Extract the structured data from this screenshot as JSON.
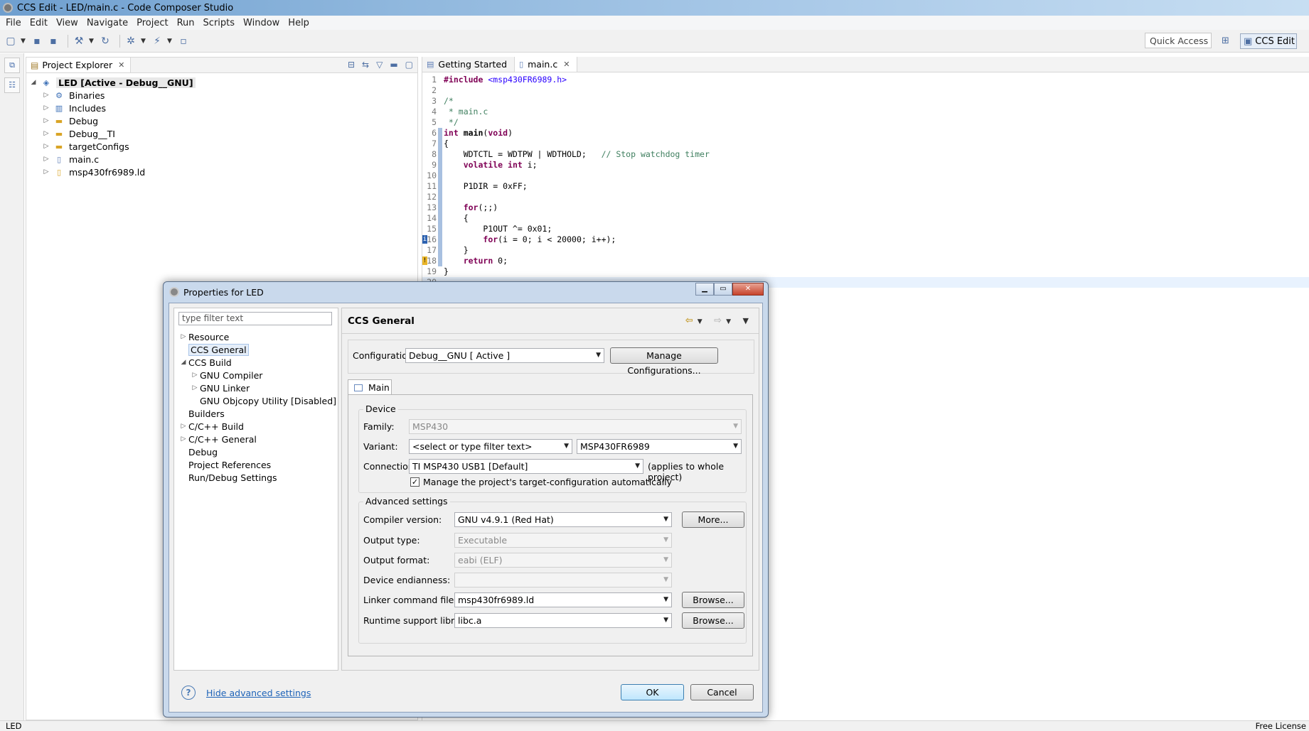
{
  "window": {
    "title": "CCS Edit - LED/main.c - Code Composer Studio"
  },
  "menu": [
    "File",
    "Edit",
    "View",
    "Navigate",
    "Project",
    "Run",
    "Scripts",
    "Window",
    "Help"
  ],
  "toolbar": {
    "quick_access": "Quick Access",
    "perspective": "CCS Edit"
  },
  "explorer": {
    "tab_label": "Project Explorer",
    "root": "LED  [Active - Debug__GNU]",
    "items": [
      "Binaries",
      "Includes",
      "Debug",
      "Debug__TI",
      "targetConfigs",
      "main.c",
      "msp430fr6989.ld"
    ],
    "icons": [
      "binaries-icon",
      "includes-icon",
      "folder-icon",
      "folder-icon",
      "folder-icon",
      "c-file-icon",
      "linker-file-icon"
    ]
  },
  "editor": {
    "tabs": [
      "Getting Started",
      "main.c"
    ],
    "lines": [
      {
        "n": "1",
        "html": "<span class=\"kw\">#include</span> <span class=\"inc\">&lt;msp430FR6989.h&gt;</span>"
      },
      {
        "n": "2",
        "html": ""
      },
      {
        "n": "3",
        "html": "<span class=\"cmt\">/*</span>"
      },
      {
        "n": "4",
        "html": "<span class=\"cmt\"> * main.c</span>"
      },
      {
        "n": "5",
        "html": "<span class=\"cmt\"> */</span>"
      },
      {
        "n": "6",
        "html": "<span class=\"kw\">int</span> <b>main</b>(<span class=\"kw\">void</span>)"
      },
      {
        "n": "7",
        "html": "{"
      },
      {
        "n": "8",
        "html": "    WDTCTL = WDTPW | WDTHOLD;   <span class=\"cmt\">// Stop watchdog timer</span>"
      },
      {
        "n": "9",
        "html": "    <span class=\"kw\">volatile</span> <span class=\"kw\">int</span> i;"
      },
      {
        "n": "10",
        "html": ""
      },
      {
        "n": "11",
        "html": "    P1DIR = 0xFF;"
      },
      {
        "n": "12",
        "html": ""
      },
      {
        "n": "13",
        "html": "    <span class=\"kw\">for</span>(;;)"
      },
      {
        "n": "14",
        "html": "    {"
      },
      {
        "n": "15",
        "html": "        P1OUT ^= 0x01;"
      },
      {
        "n": "16",
        "html": "        <span class=\"kw\">for</span>(i = 0; i &lt; 20000; i++);"
      },
      {
        "n": "17",
        "html": "    }"
      },
      {
        "n": "18",
        "html": "    <span class=\"kw\">return</span> 0;"
      },
      {
        "n": "19",
        "html": "}"
      },
      {
        "n": "20",
        "html": ""
      }
    ]
  },
  "status": {
    "left": "LED",
    "right": "Free License"
  },
  "dialog": {
    "title": "Properties for LED",
    "filter_placeholder": "type filter text",
    "tree": [
      {
        "label": "Resource",
        "twisty": "▷",
        "indent": 0,
        "selected": false
      },
      {
        "label": "CCS General",
        "twisty": "",
        "indent": 0,
        "selected": true
      },
      {
        "label": "CCS Build",
        "twisty": "◢",
        "indent": 0,
        "selected": false
      },
      {
        "label": "GNU Compiler",
        "twisty": "▷",
        "indent": 1,
        "selected": false
      },
      {
        "label": "GNU Linker",
        "twisty": "▷",
        "indent": 1,
        "selected": false
      },
      {
        "label": "GNU Objcopy Utility  [Disabled]",
        "twisty": "",
        "indent": 1,
        "selected": false
      },
      {
        "label": "Builders",
        "twisty": "",
        "indent": 0,
        "selected": false
      },
      {
        "label": "C/C++ Build",
        "twisty": "▷",
        "indent": 0,
        "selected": false
      },
      {
        "label": "C/C++ General",
        "twisty": "▷",
        "indent": 0,
        "selected": false
      },
      {
        "label": "Debug",
        "twisty": "",
        "indent": 0,
        "selected": false
      },
      {
        "label": "Project References",
        "twisty": "",
        "indent": 0,
        "selected": false
      },
      {
        "label": "Run/Debug Settings",
        "twisty": "",
        "indent": 0,
        "selected": false
      }
    ],
    "page_title": "CCS General",
    "configuration_label": "Configuration:",
    "configuration_value": "Debug__GNU  [ Active ]",
    "manage_configs": "Manage Configurations...",
    "main_tab": "Main",
    "device_group": "Device",
    "family_label": "Family:",
    "family_value": "MSP430",
    "variant_label": "Variant:",
    "variant_filter": "<select or type filter text>",
    "variant_value": "MSP430FR6989",
    "connection_label": "Connection:",
    "connection_value": "TI MSP430 USB1 [Default]",
    "connection_note": "(applies to whole project)",
    "manage_target_label": "Manage the project's target-configuration automatically",
    "manage_target_checked": "✓",
    "advanced_group": "Advanced settings",
    "compiler_label": "Compiler version:",
    "compiler_value": "GNU v4.9.1 (Red Hat)",
    "more_button": "More...",
    "output_type_label": "Output type:",
    "output_type_value": "Executable",
    "output_format_label": "Output format:",
    "output_format_value": "eabi (ELF)",
    "endianness_label": "Device endianness:",
    "endianness_value": "",
    "linker_label": "Linker command file:",
    "linker_value": "msp430fr6989.ld",
    "runtime_label": "Runtime support library:",
    "runtime_value": "libc.a",
    "browse_button": "Browse...",
    "help_link": "Hide advanced settings",
    "ok_button": "OK",
    "cancel_button": "Cancel"
  }
}
